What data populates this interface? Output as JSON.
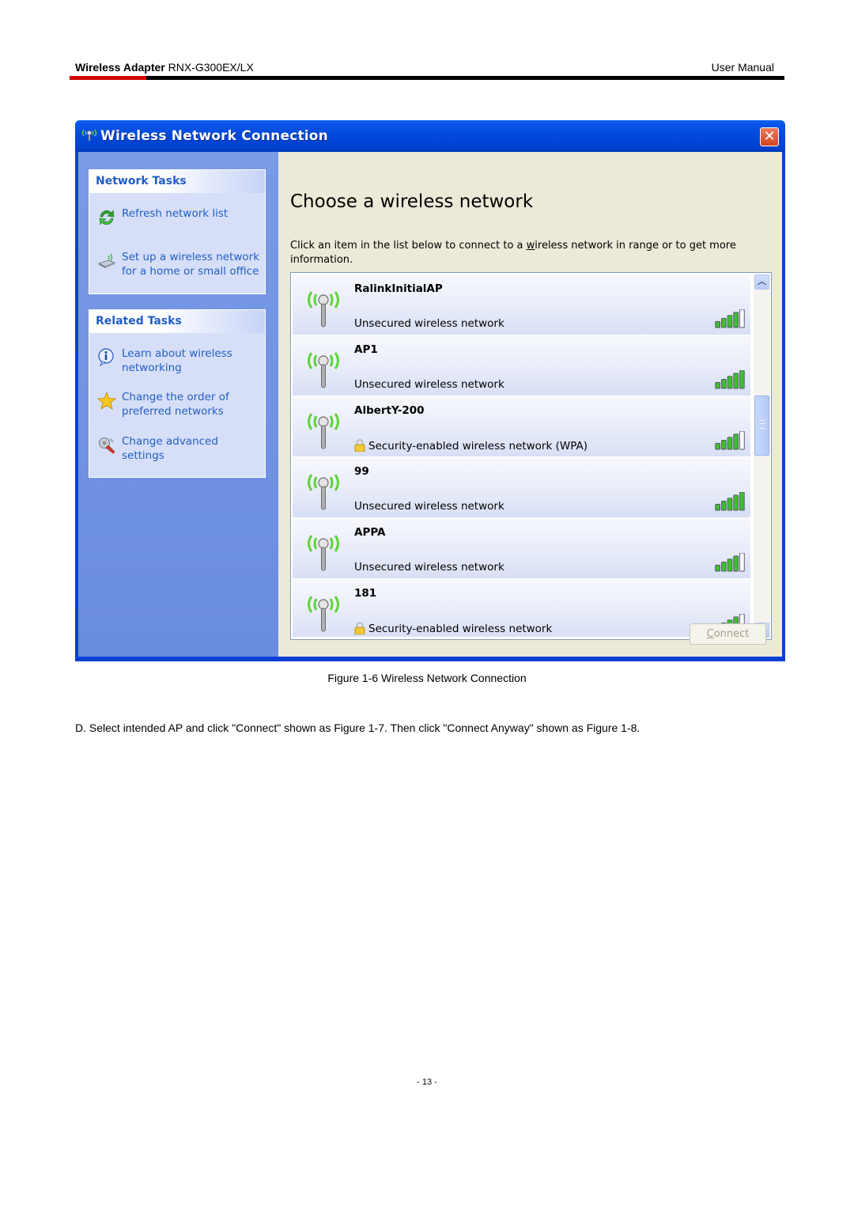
{
  "doc_header": {
    "product_bold": "Wireless Adapter",
    "product_model": " RNX-G300EX/LX",
    "manual_label": "User Manual",
    "accent_color": "#d40000"
  },
  "window": {
    "title": "Wireless Network Connection",
    "close_label": "✕",
    "sidebar": {
      "network_tasks": {
        "heading": "Network Tasks",
        "items": [
          {
            "label": "Refresh network list",
            "icon": "refresh-icon"
          },
          {
            "label": "Set up a wireless network for a home or small office",
            "icon": "wireless-setup-icon"
          }
        ]
      },
      "related_tasks": {
        "heading": "Related Tasks",
        "items": [
          {
            "label": "Learn about wireless networking",
            "icon": "info-icon"
          },
          {
            "label": "Change the order of preferred networks",
            "icon": "star-icon"
          },
          {
            "label": "Change advanced settings",
            "icon": "settings-icon"
          }
        ]
      }
    },
    "main": {
      "title": "Choose a wireless network",
      "description_pre": "Click an item in the list below to connect to a ",
      "description_underlined": "w",
      "description_post": "ireless network in range or to get more information.",
      "networks": [
        {
          "name": "RalinkInitialAP",
          "status": "Unsecured wireless network",
          "secured": false,
          "signal_bars": 4,
          "signal_max": 5
        },
        {
          "name": "AP1",
          "status": "Unsecured wireless network",
          "secured": false,
          "signal_bars": 5,
          "signal_max": 5
        },
        {
          "name": "AlbertY-200",
          "status": "Security-enabled wireless network (WPA)",
          "secured": true,
          "signal_bars": 4,
          "signal_max": 5
        },
        {
          "name": "99",
          "status": "Unsecured wireless network",
          "secured": false,
          "signal_bars": 5,
          "signal_max": 5
        },
        {
          "name": "APPA",
          "status": "Unsecured wireless network",
          "secured": false,
          "signal_bars": 4,
          "signal_max": 5
        },
        {
          "name": "181",
          "status": "Security-enabled wireless network",
          "secured": true,
          "signal_bars": 4,
          "signal_max": 5
        }
      ],
      "scroll_up": "︿",
      "scroll_down": "﹀",
      "connect_button": {
        "accel": "C",
        "rest": "onnect",
        "enabled": false
      }
    }
  },
  "caption": "Figure 1-6 Wireless Network Connection",
  "instruction": "D. Select intended AP and click \"Connect\" shown as Figure 1-7. Then click \"Connect Anyway\" shown as Figure 1-8.",
  "page_number": "- 13 -"
}
